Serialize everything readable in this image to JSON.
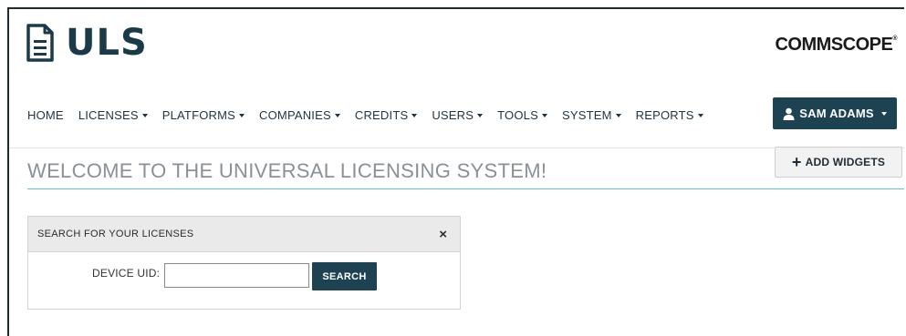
{
  "app": {
    "logo_text": "ULS",
    "brand_text": "COMMSCOPE",
    "brand_mark": "®"
  },
  "nav": {
    "items": [
      {
        "label": "HOME",
        "has_caret": false
      },
      {
        "label": "LICENSES",
        "has_caret": true
      },
      {
        "label": "PLATFORMS",
        "has_caret": true
      },
      {
        "label": "COMPANIES",
        "has_caret": true
      },
      {
        "label": "CREDITS",
        "has_caret": true
      },
      {
        "label": "USERS",
        "has_caret": true
      },
      {
        "label": "TOOLS",
        "has_caret": true
      },
      {
        "label": "SYSTEM",
        "has_caret": true
      },
      {
        "label": "REPORTS",
        "has_caret": true
      }
    ]
  },
  "user_menu": {
    "label": "SAM ADAMS",
    "icon": "user-icon"
  },
  "main": {
    "title": "WELCOME TO THE UNIVERSAL LICENSING SYSTEM!",
    "add_widgets_label": "ADD WIDGETS",
    "add_widgets_icon": "+"
  },
  "widget": {
    "title": "SEARCH FOR YOUR LICENSES",
    "close_icon": "×",
    "device_label": "DEVICE UID:",
    "device_value": "",
    "search_label": "SEARCH"
  },
  "colors": {
    "brand_dark": "#1d4353",
    "title_gray": "#8a9097",
    "accent_rule": "#5ec3d8"
  }
}
